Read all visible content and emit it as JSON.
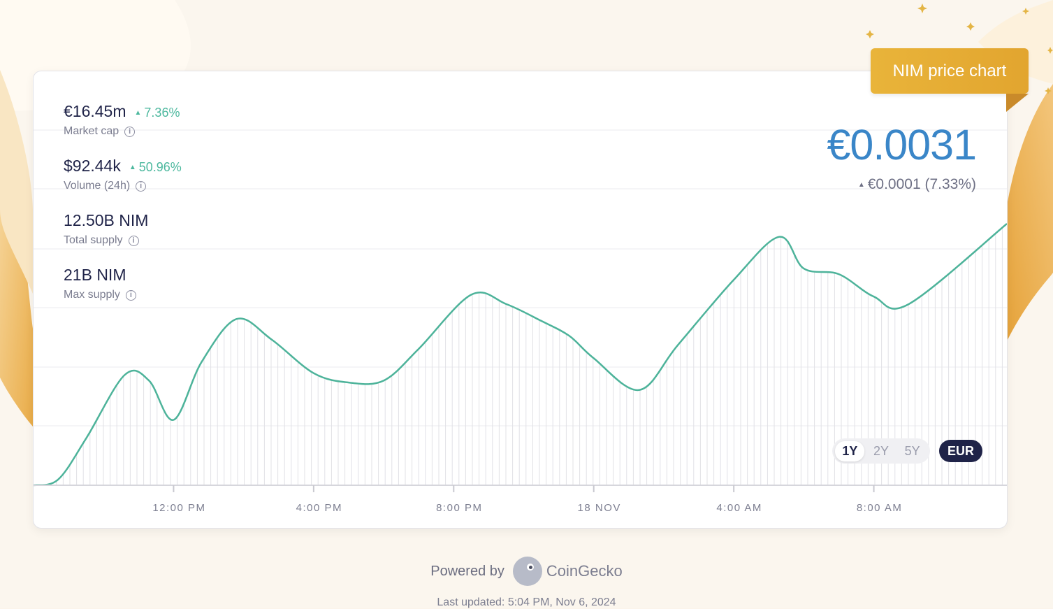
{
  "badge": {
    "label": "NIM price chart"
  },
  "stats": [
    {
      "value": "€16.45m",
      "change": "7.36%",
      "label": "Market cap"
    },
    {
      "value": "$92.44k",
      "change": "50.96%",
      "label": "Volume (24h)"
    },
    {
      "value": "12.50B NIM",
      "change": "",
      "label": "Total supply"
    },
    {
      "value": "21B NIM",
      "change": "",
      "label": "Max supply"
    }
  ],
  "price": {
    "current": "€0.0031",
    "change": "€0.0001 (7.33%)"
  },
  "ranges": [
    "1Y",
    "2Y",
    "5Y"
  ],
  "currency": "EUR",
  "footer": {
    "powered_by": "Powered by",
    "brand": "CoinGecko",
    "updated": "Last updated: 5:04 PM, Nov 6, 2024"
  },
  "colors": {
    "line": "#4db39a",
    "accent": "#3a86c8",
    "badge": "#e5ad34"
  },
  "chart_data": {
    "type": "line",
    "xlabel": "",
    "ylabel": "",
    "x_tick_labels": [
      "12:00 PM",
      "4:00 PM",
      "8:00 PM",
      "18 NOV",
      "4:00 AM",
      "8:00 AM"
    ],
    "x_tick_hours": [
      4,
      8,
      12,
      16,
      20,
      24
    ],
    "y_range": [
      0,
      1
    ],
    "grid": true,
    "series": [
      {
        "values": [
          [
            0,
            0.0
          ],
          [
            0.7,
            0.03
          ],
          [
            1.5,
            0.25
          ],
          [
            2.6,
            0.59
          ],
          [
            3.3,
            0.56
          ],
          [
            4.0,
            0.35
          ],
          [
            4.8,
            0.66
          ],
          [
            5.8,
            0.89
          ],
          [
            6.8,
            0.78
          ],
          [
            8.0,
            0.6
          ],
          [
            9.0,
            0.55
          ],
          [
            10.0,
            0.56
          ],
          [
            11.0,
            0.73
          ],
          [
            12.5,
            1.02
          ],
          [
            13.5,
            0.97
          ],
          [
            14.5,
            0.88
          ],
          [
            15.3,
            0.8
          ],
          [
            16.0,
            0.68
          ],
          [
            17.3,
            0.51
          ],
          [
            18.4,
            0.75
          ],
          [
            20.0,
            1.1
          ],
          [
            21.3,
            1.33
          ],
          [
            22.0,
            1.16
          ],
          [
            23.0,
            1.13
          ],
          [
            24.0,
            1.01
          ],
          [
            25.0,
            0.97
          ],
          [
            27.8,
            1.4
          ]
        ]
      }
    ]
  }
}
